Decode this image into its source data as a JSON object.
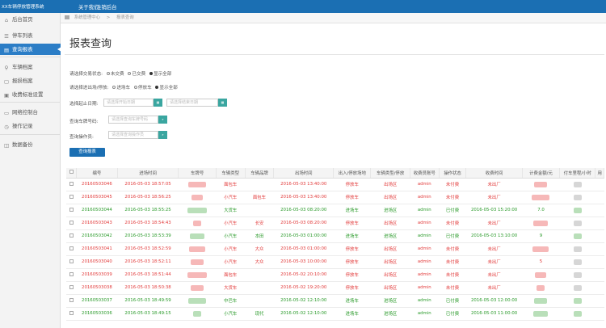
{
  "app": {
    "title": "XX车辆停放管理系统",
    "nav": [
      "关于我们",
      "注销后台"
    ]
  },
  "sidebar": {
    "items": [
      {
        "label": "后台首页",
        "icon": "home-icon"
      },
      {
        "label": "停车列表",
        "icon": "list-icon"
      },
      {
        "label": "查询报表",
        "icon": "report-icon",
        "active": true
      },
      {
        "label": "车辆档案",
        "icon": "car-icon"
      },
      {
        "label": "报损档案",
        "icon": "file-icon"
      },
      {
        "label": "收费标准设置",
        "icon": "setting-icon"
      },
      {
        "label": "网络控制台",
        "icon": "network-icon"
      },
      {
        "label": "操作记录",
        "icon": "clock-icon"
      },
      {
        "label": "数据备份",
        "icon": "database-icon"
      }
    ]
  },
  "breadcrumb": {
    "items": [
      "系统管理中心",
      "报表查询"
    ]
  },
  "page": {
    "title": "报表查询"
  },
  "filters": {
    "status_label": "请选择交易状态:",
    "status_options": [
      "未交费",
      "已交费",
      "显示全部"
    ],
    "status_selected": 2,
    "mode_label": "请选择进出场/停放:",
    "mode_options": [
      "进场车",
      "停放车",
      "显示全部"
    ],
    "mode_selected": 2,
    "date_label": "选择起止日期:",
    "date_start_placeholder": "请选择开始日期",
    "date_end_placeholder": "请选择结束日期",
    "plate_label": "查询车牌号码:",
    "plate_placeholder": "请选择查询车牌号码",
    "manager_label": "查询操作员:",
    "manager_placeholder": "请选择查询操作员",
    "query_button": "查询报表"
  },
  "table": {
    "headers": [
      "编号",
      "进场时间",
      "车牌号",
      "车辆类型",
      "车辆品牌",
      "出场时间",
      "出入/停放场地",
      "车辆类型/停放",
      "收费员账号",
      "操作状态",
      "收费时间",
      "计费金额/元",
      "付车里程/小时",
      "用"
    ],
    "rows": [
      {
        "id": "20160503046",
        "in": "2016-05-03 18:57:05",
        "type": "面包车",
        "brand": "",
        "out": "2016-05-03 13:40:00",
        "area": "停放车",
        "cat": "出场区",
        "op": "admin",
        "state": "未付费",
        "paytime": "未出厂",
        "green": false
      },
      {
        "id": "20160503045",
        "in": "2016-05-03 18:56:25",
        "type": "小汽车",
        "brand": "面包车",
        "out": "2016-05-03 13:40:00",
        "area": "停放车",
        "cat": "出场区",
        "op": "admin",
        "state": "未付费",
        "paytime": "未出厂",
        "green": false
      },
      {
        "id": "20160503044",
        "in": "2016-05-03 18:55:25",
        "type": "大货车",
        "brand": "",
        "out": "2016-05-03 08:20:00",
        "area": "进场车",
        "cat": "进场区",
        "op": "admin",
        "state": "已付费",
        "paytime": "2016-05-03 15:20:00",
        "fee": "7.0",
        "green": true
      },
      {
        "id": "20160503043",
        "in": "2016-05-03 18:54:43",
        "type": "小汽车",
        "brand": "长安",
        "out": "2016-05-03 08:20:00",
        "area": "停放车",
        "cat": "出场区",
        "op": "admin",
        "state": "未付费",
        "paytime": "未出厂",
        "green": false
      },
      {
        "id": "20160503042",
        "in": "2016-05-03 18:53:39",
        "type": "小汽车",
        "brand": "本田",
        "out": "2016-05-03 01:00:00",
        "area": "进场车",
        "cat": "进场区",
        "op": "admin",
        "state": "已付费",
        "paytime": "2016-05-03 13:10:00",
        "fee": "9",
        "green": true
      },
      {
        "id": "20160503041",
        "in": "2016-05-03 18:52:59",
        "type": "小汽车",
        "brand": "大众",
        "out": "2016-05-03 01:00:00",
        "area": "停放车",
        "cat": "出场区",
        "op": "admin",
        "state": "未付费",
        "paytime": "未出厂",
        "green": false
      },
      {
        "id": "20160503040",
        "in": "2016-05-03 18:52:11",
        "type": "小汽车",
        "brand": "大众",
        "out": "2016-05-03 10:00:00",
        "area": "停放车",
        "cat": "出场区",
        "op": "admin",
        "state": "未付费",
        "paytime": "未出厂",
        "fee": "5",
        "green": false
      },
      {
        "id": "20160503039",
        "in": "2016-05-03 18:51:44",
        "type": "面包车",
        "brand": "",
        "out": "2016-05-02 20:10:00",
        "area": "停放车",
        "cat": "出场区",
        "op": "admin",
        "state": "未付费",
        "paytime": "未出厂",
        "green": false
      },
      {
        "id": "20160503038",
        "in": "2016-05-03 18:50:38",
        "type": "大货车",
        "brand": "",
        "out": "2016-05-02 19:20:00",
        "area": "停放车",
        "cat": "出场区",
        "op": "admin",
        "state": "未付费",
        "paytime": "未出厂",
        "green": false
      },
      {
        "id": "20160503037",
        "in": "2016-05-03 18:49:59",
        "type": "中巴车",
        "brand": "",
        "out": "2016-05-02 12:10:00",
        "area": "进场车",
        "cat": "进场区",
        "op": "admin",
        "state": "已付费",
        "paytime": "2016-05-03 12:00:00",
        "green": true
      },
      {
        "id": "20160503036",
        "in": "2016-05-03 18:49:15",
        "type": "小汽车",
        "brand": "现代",
        "out": "2016-05-02 12:10:00",
        "area": "进场车",
        "cat": "进场区",
        "op": "admin",
        "state": "已付费",
        "paytime": "2016-05-03 11:00:00",
        "green": true
      }
    ]
  },
  "colors": {
    "primary": "#1b6fb3",
    "red_text": "#e23b3b",
    "green_text": "#2a9a2a"
  }
}
